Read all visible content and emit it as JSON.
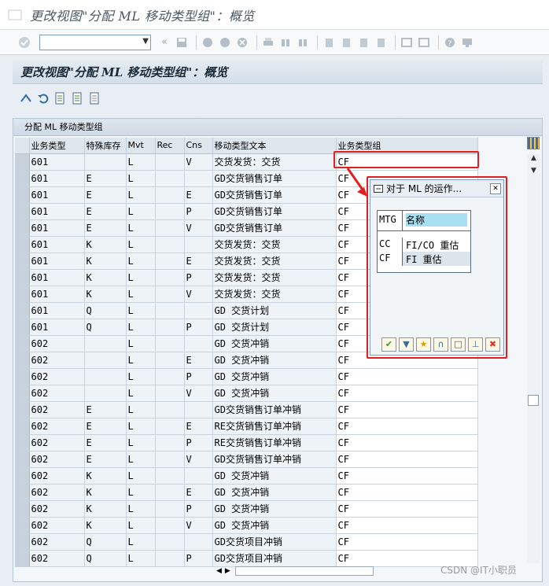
{
  "window": {
    "title": "更改视图\"分配 ML 移动类型组\"：概览"
  },
  "toolbar": {
    "command_value": "",
    "icons": [
      "enter-icon",
      "back-icon",
      "save-icon",
      "nav-back-icon",
      "nav-exit-icon",
      "cancel-icon",
      "print-icon",
      "find-icon",
      "find-next-icon",
      "first-page-icon",
      "prev-page-icon",
      "next-page-icon",
      "last-page-icon",
      "create-session-icon",
      "shortcut-icon",
      "help-icon",
      "layout-icon"
    ]
  },
  "screen": {
    "header": "更改视图\"分配 ML 移动类型组\"：概览"
  },
  "app_toolbar": {
    "icons": [
      "display-change-icon",
      "undo-icon",
      "new-entries-icon",
      "copy-icon",
      "delete-icon"
    ]
  },
  "table": {
    "title": "分配 ML 移动类型组",
    "columns": [
      "业务类型",
      "特殊库存",
      "Mvt",
      "Rec",
      "Cns",
      "移动类型文本",
      "业务类型组"
    ],
    "rows": [
      [
        "601",
        "",
        "L",
        "",
        "V",
        "交货发货：交货",
        "CF"
      ],
      [
        "601",
        "E",
        "L",
        "",
        "",
        "GD交货销售订单",
        "CF"
      ],
      [
        "601",
        "E",
        "L",
        "",
        "E",
        "GD交货销售订单",
        "CF"
      ],
      [
        "601",
        "E",
        "L",
        "",
        "P",
        "GD交货销售订单",
        "CF"
      ],
      [
        "601",
        "E",
        "L",
        "",
        "V",
        "GD交货销售订单",
        "CF"
      ],
      [
        "601",
        "K",
        "L",
        "",
        "",
        "交货发货：交货",
        "CF"
      ],
      [
        "601",
        "K",
        "L",
        "",
        "E",
        "交货发货：交货",
        "CF"
      ],
      [
        "601",
        "K",
        "L",
        "",
        "P",
        "交货发货：交货",
        "CF"
      ],
      [
        "601",
        "K",
        "L",
        "",
        "V",
        "交货发货：交货",
        "CF"
      ],
      [
        "601",
        "Q",
        "L",
        "",
        "",
        "GD 交货计划",
        "CF"
      ],
      [
        "601",
        "Q",
        "L",
        "",
        "P",
        "GD 交货计划",
        "CF"
      ],
      [
        "602",
        "",
        "L",
        "",
        "",
        "GD 交货冲销",
        "CF"
      ],
      [
        "602",
        "",
        "L",
        "",
        "E",
        "GD 交货冲销",
        "CF"
      ],
      [
        "602",
        "",
        "L",
        "",
        "P",
        "GD 交货冲销",
        "CF"
      ],
      [
        "602",
        "",
        "L",
        "",
        "V",
        "GD 交货冲销",
        "CF"
      ],
      [
        "602",
        "E",
        "L",
        "",
        "",
        "GD交货销售订单冲销",
        "CF"
      ],
      [
        "602",
        "E",
        "L",
        "",
        "E",
        "RE交货销售订单冲销",
        "CF"
      ],
      [
        "602",
        "E",
        "L",
        "",
        "P",
        "RE交货销售订单冲销",
        "CF"
      ],
      [
        "602",
        "E",
        "L",
        "",
        "V",
        "GD交货销售订单冲销",
        "CF"
      ],
      [
        "602",
        "K",
        "L",
        "",
        "",
        "GD 交货冲销",
        "CF"
      ],
      [
        "602",
        "K",
        "L",
        "",
        "E",
        "GD 交货冲销",
        "CF"
      ],
      [
        "602",
        "K",
        "L",
        "",
        "P",
        "GD 交货冲销",
        "CF"
      ],
      [
        "602",
        "K",
        "L",
        "",
        "V",
        "GD 交货冲销",
        "CF"
      ],
      [
        "602",
        "Q",
        "L",
        "",
        "",
        "GD交货项目冲销",
        "CF"
      ],
      [
        "602",
        "Q",
        "L",
        "",
        "P",
        "GD交货项目冲销",
        "CF"
      ]
    ]
  },
  "popup": {
    "title": "对于 ML 的运作...",
    "header_code": "MTG",
    "header_name": "名称",
    "entries": [
      {
        "code": "CC",
        "name": "FI/CO 重估"
      },
      {
        "code": "CF",
        "name": "FI 重估"
      }
    ],
    "buttons": [
      "confirm-icon",
      "filter-icon",
      "sort-icon",
      "find-icon",
      "new-icon",
      "pin-icon",
      "cancel-icon"
    ]
  },
  "watermark": "CSDN @IT小职员",
  "colors": {
    "highlight": "#e02020",
    "popup_name_bg": "#a7e0f2"
  }
}
